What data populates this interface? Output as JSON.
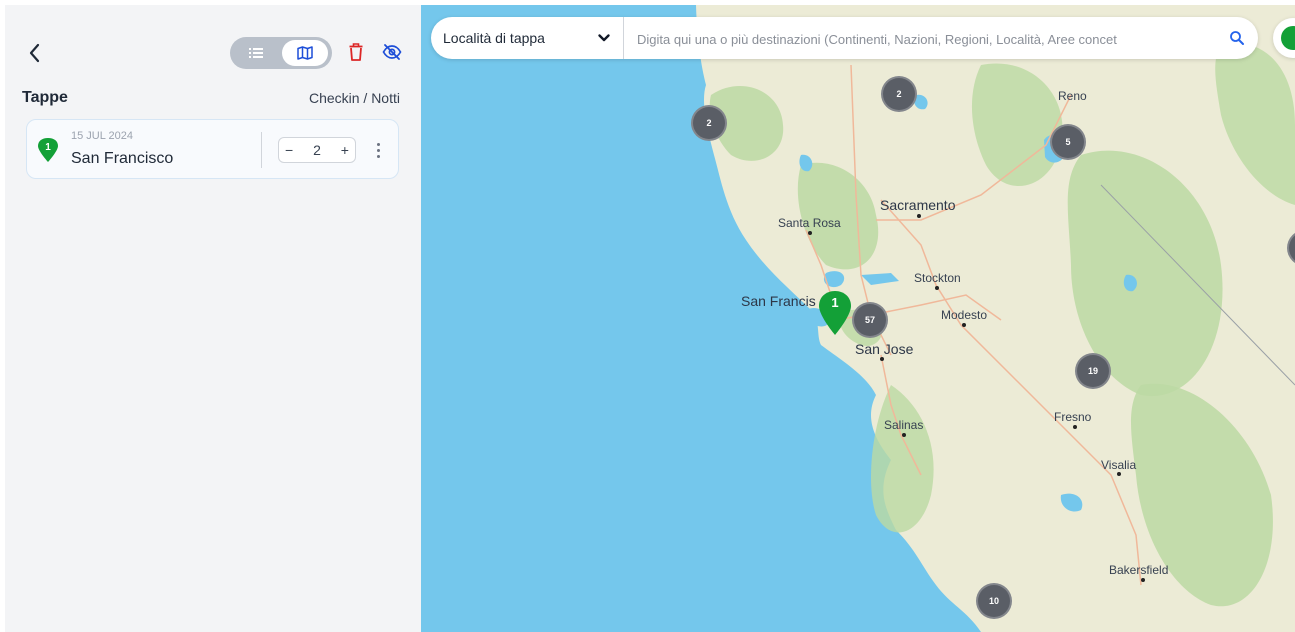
{
  "sidebar": {
    "title": "Tappe",
    "checkin_label": "Checkin / Notti",
    "stages": [
      {
        "number": "1",
        "date": "15 JUL 2024",
        "city": "San Francisco",
        "nights": "2",
        "minus": "−",
        "plus": "+"
      }
    ]
  },
  "search": {
    "select_label": "Località di tappa",
    "placeholder": "Digita qui una o più destinazioni (Continenti, Nazioni, Regioni, Località, Aree concet"
  },
  "map": {
    "cities": {
      "reno": "Reno",
      "sacramento": "Sacramento",
      "santa_rosa": "Santa Rosa",
      "stockton": "Stockton",
      "san_francisco": "San Francis",
      "modesto": "Modesto",
      "san_jose": "San Jose",
      "salinas": "Salinas",
      "fresno": "Fresno",
      "visalia": "Visalia",
      "bakersfield": "Bakersfield"
    },
    "clusters": [
      "2",
      "2",
      "5",
      "57",
      "19",
      "10"
    ],
    "pin_number": "1"
  },
  "colors": {
    "ocean": "#74c7ec",
    "land": "#ecebd6",
    "vegetation": "#bcd9a3",
    "cluster": "#5a5e66",
    "pin": "#13a037",
    "accent": "#2563eb",
    "danger": "#dc2626"
  }
}
